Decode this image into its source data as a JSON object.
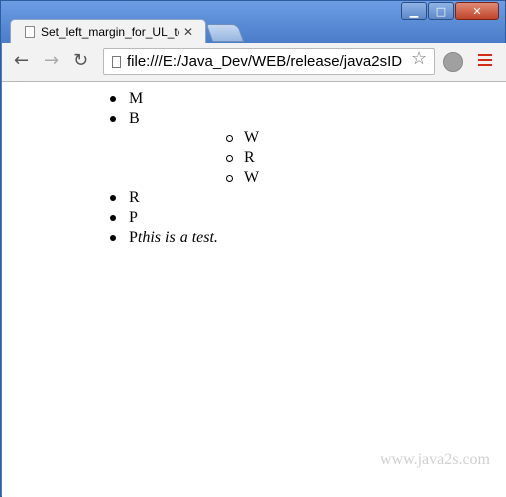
{
  "window": {
    "minimize_glyph": "▁",
    "maximize_glyph": "□",
    "close_glyph": "✕"
  },
  "tab": {
    "title": "Set_left_margin_for_UL_to",
    "close_glyph": "✕"
  },
  "toolbar": {
    "back_glyph": "←",
    "forward_glyph": "→",
    "reload_glyph": "↻",
    "url": "file:///E:/Java_Dev/WEB/release/java2sID",
    "star_glyph": "☆",
    "menu_color": "#d42a1c"
  },
  "page": {
    "outer_list": [
      "M",
      "B",
      "R",
      "P"
    ],
    "nested_list": [
      "W",
      "R",
      "W"
    ],
    "last_item_prefix": "P",
    "last_item_emphasis": "this is a test."
  },
  "watermark": "www.java2s.com"
}
